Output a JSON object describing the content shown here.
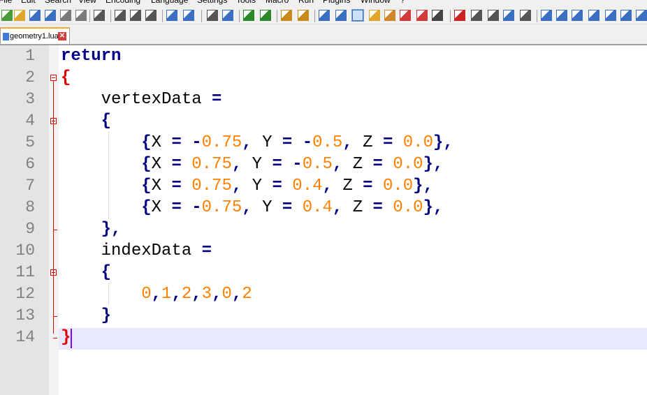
{
  "menu": [
    "File",
    "Edit",
    "Search",
    "View",
    "Encoding",
    "Language",
    "Settings",
    "Tools",
    "Macro",
    "Run",
    "Plugins",
    "Window",
    "?"
  ],
  "tab": {
    "filename": "geometry1.lua",
    "close": "✕"
  },
  "editor": {
    "line_numbers": [
      "1",
      "2",
      "3",
      "4",
      "5",
      "6",
      "7",
      "8",
      "9",
      "10",
      "11",
      "12",
      "13",
      "14"
    ],
    "lines": [
      [
        {
          "t": "return",
          "c": "kw"
        }
      ],
      [
        {
          "t": "{",
          "c": "brace-red"
        }
      ],
      [
        {
          "t": "    vertexData ",
          "c": "id"
        },
        {
          "t": "=",
          "c": "op"
        }
      ],
      [
        {
          "t": "    ",
          "c": "id"
        },
        {
          "t": "{",
          "c": "op"
        }
      ],
      [
        {
          "t": "        ",
          "c": "id"
        },
        {
          "t": "{",
          "c": "op"
        },
        {
          "t": "X ",
          "c": "id"
        },
        {
          "t": "=",
          "c": "op"
        },
        {
          "t": " ",
          "c": "id"
        },
        {
          "t": "-",
          "c": "op"
        },
        {
          "t": "0.75",
          "c": "num"
        },
        {
          "t": ",",
          "c": "op"
        },
        {
          "t": " Y ",
          "c": "id"
        },
        {
          "t": "=",
          "c": "op"
        },
        {
          "t": " ",
          "c": "id"
        },
        {
          "t": "-",
          "c": "op"
        },
        {
          "t": "0.5",
          "c": "num"
        },
        {
          "t": ",",
          "c": "op"
        },
        {
          "t": " Z ",
          "c": "id"
        },
        {
          "t": "=",
          "c": "op"
        },
        {
          "t": " ",
          "c": "id"
        },
        {
          "t": "0.0",
          "c": "num"
        },
        {
          "t": "},",
          "c": "op"
        }
      ],
      [
        {
          "t": "        ",
          "c": "id"
        },
        {
          "t": "{",
          "c": "op"
        },
        {
          "t": "X ",
          "c": "id"
        },
        {
          "t": "=",
          "c": "op"
        },
        {
          "t": " ",
          "c": "id"
        },
        {
          "t": "0.75",
          "c": "num"
        },
        {
          "t": ",",
          "c": "op"
        },
        {
          "t": " Y ",
          "c": "id"
        },
        {
          "t": "=",
          "c": "op"
        },
        {
          "t": " ",
          "c": "id"
        },
        {
          "t": "-",
          "c": "op"
        },
        {
          "t": "0.5",
          "c": "num"
        },
        {
          "t": ",",
          "c": "op"
        },
        {
          "t": " Z ",
          "c": "id"
        },
        {
          "t": "=",
          "c": "op"
        },
        {
          "t": " ",
          "c": "id"
        },
        {
          "t": "0.0",
          "c": "num"
        },
        {
          "t": "},",
          "c": "op"
        }
      ],
      [
        {
          "t": "        ",
          "c": "id"
        },
        {
          "t": "{",
          "c": "op"
        },
        {
          "t": "X ",
          "c": "id"
        },
        {
          "t": "=",
          "c": "op"
        },
        {
          "t": " ",
          "c": "id"
        },
        {
          "t": "0.75",
          "c": "num"
        },
        {
          "t": ",",
          "c": "op"
        },
        {
          "t": " Y ",
          "c": "id"
        },
        {
          "t": "=",
          "c": "op"
        },
        {
          "t": " ",
          "c": "id"
        },
        {
          "t": "0.4",
          "c": "num"
        },
        {
          "t": ",",
          "c": "op"
        },
        {
          "t": " Z ",
          "c": "id"
        },
        {
          "t": "=",
          "c": "op"
        },
        {
          "t": " ",
          "c": "id"
        },
        {
          "t": "0.0",
          "c": "num"
        },
        {
          "t": "},",
          "c": "op"
        }
      ],
      [
        {
          "t": "        ",
          "c": "id"
        },
        {
          "t": "{",
          "c": "op"
        },
        {
          "t": "X ",
          "c": "id"
        },
        {
          "t": "=",
          "c": "op"
        },
        {
          "t": " ",
          "c": "id"
        },
        {
          "t": "-",
          "c": "op"
        },
        {
          "t": "0.75",
          "c": "num"
        },
        {
          "t": ",",
          "c": "op"
        },
        {
          "t": " Y ",
          "c": "id"
        },
        {
          "t": "=",
          "c": "op"
        },
        {
          "t": " ",
          "c": "id"
        },
        {
          "t": "0.4",
          "c": "num"
        },
        {
          "t": ",",
          "c": "op"
        },
        {
          "t": " Z ",
          "c": "id"
        },
        {
          "t": "=",
          "c": "op"
        },
        {
          "t": " ",
          "c": "id"
        },
        {
          "t": "0.0",
          "c": "num"
        },
        {
          "t": "},",
          "c": "op"
        }
      ],
      [
        {
          "t": "    ",
          "c": "id"
        },
        {
          "t": "},",
          "c": "op"
        }
      ],
      [
        {
          "t": "    indexData ",
          "c": "id"
        },
        {
          "t": "=",
          "c": "op"
        }
      ],
      [
        {
          "t": "    ",
          "c": "id"
        },
        {
          "t": "{",
          "c": "op"
        }
      ],
      [
        {
          "t": "        ",
          "c": "id"
        },
        {
          "t": "0",
          "c": "num"
        },
        {
          "t": ",",
          "c": "op"
        },
        {
          "t": "1",
          "c": "num"
        },
        {
          "t": ",",
          "c": "op"
        },
        {
          "t": "2",
          "c": "num"
        },
        {
          "t": ",",
          "c": "op"
        },
        {
          "t": "3",
          "c": "num"
        },
        {
          "t": ",",
          "c": "op"
        },
        {
          "t": "0",
          "c": "num"
        },
        {
          "t": ",",
          "c": "op"
        },
        {
          "t": "2",
          "c": "num"
        }
      ],
      [
        {
          "t": "    ",
          "c": "id"
        },
        {
          "t": "}",
          "c": "op"
        }
      ],
      [
        {
          "t": "}",
          "c": "brace-red"
        }
      ]
    ]
  },
  "toolbar_icons": [
    "new-file",
    "open-file",
    "save",
    "save-all",
    "close",
    "close-all",
    "print",
    "cut",
    "copy",
    "paste",
    "undo",
    "redo",
    "find",
    "replace",
    "zoom-in",
    "zoom-out",
    "sync-vertical",
    "sync-horizontal",
    "word-wrap",
    "show-all-chars",
    "indent-guide",
    "udl",
    "doc-map",
    "function-list",
    "folder-workspace",
    "monitoring",
    "record-macro",
    "stop-macro",
    "play-macro",
    "run-macro-multiple",
    "save-macro",
    "plugin-a",
    "plugin-b",
    "plugin-c",
    "plugin-d",
    "up",
    "down",
    "plugin-e"
  ]
}
